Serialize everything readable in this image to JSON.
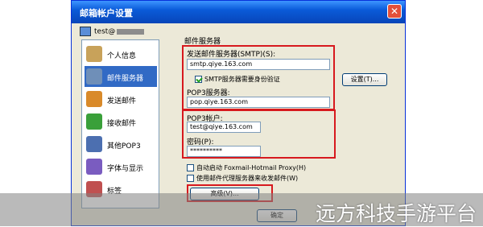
{
  "window": {
    "title": "邮箱帐户设置",
    "close_glyph": "✕"
  },
  "account": {
    "name_prefix": "test@"
  },
  "categories": [
    {
      "label": "个人信息",
      "icon": "user-card-icon",
      "color": "#c8a25a"
    },
    {
      "label": "邮件服务器",
      "icon": "server-icon",
      "color": "#6f8fb8",
      "selected": true
    },
    {
      "label": "发送邮件",
      "icon": "send-mail-icon",
      "color": "#d98a2a"
    },
    {
      "label": "接收邮件",
      "icon": "receive-mail-icon",
      "color": "#3aa03a"
    },
    {
      "label": "其他POP3",
      "icon": "pop3-icon",
      "color": "#4c6fb0"
    },
    {
      "label": "字体与显示",
      "icon": "font-icon",
      "color": "#7a5cc0"
    },
    {
      "label": "标签",
      "icon": "tag-icon",
      "color": "#c05050"
    }
  ],
  "server_section": {
    "group_title": "邮件服务器",
    "smtp_label": "发送邮件服务器(SMTP)(S):",
    "smtp_value": "smtp.qiye.163.com",
    "smtp_auth_label": "SMTP服务器需要身份验证",
    "smtp_auth_checked": true,
    "settings_button": "设置(T)...",
    "pop3_label": "POP3服务器:",
    "pop3_value": "pop.qiye.163.com",
    "account_label": "POP3帐户:",
    "account_value": "test@qiye.163.com",
    "password_label": "密码(P):",
    "password_value": "**********",
    "foxmail_option": "自动启动 Foxmail-Hotmail Proxy(H)",
    "proxy_option": "使用邮件代理服务器来收发邮件(W)",
    "advanced_button": "高级(V)..."
  },
  "footer": {
    "ok_button": "确定"
  },
  "watermark": "远方科技手游平台",
  "accent_color": "#d7191e"
}
